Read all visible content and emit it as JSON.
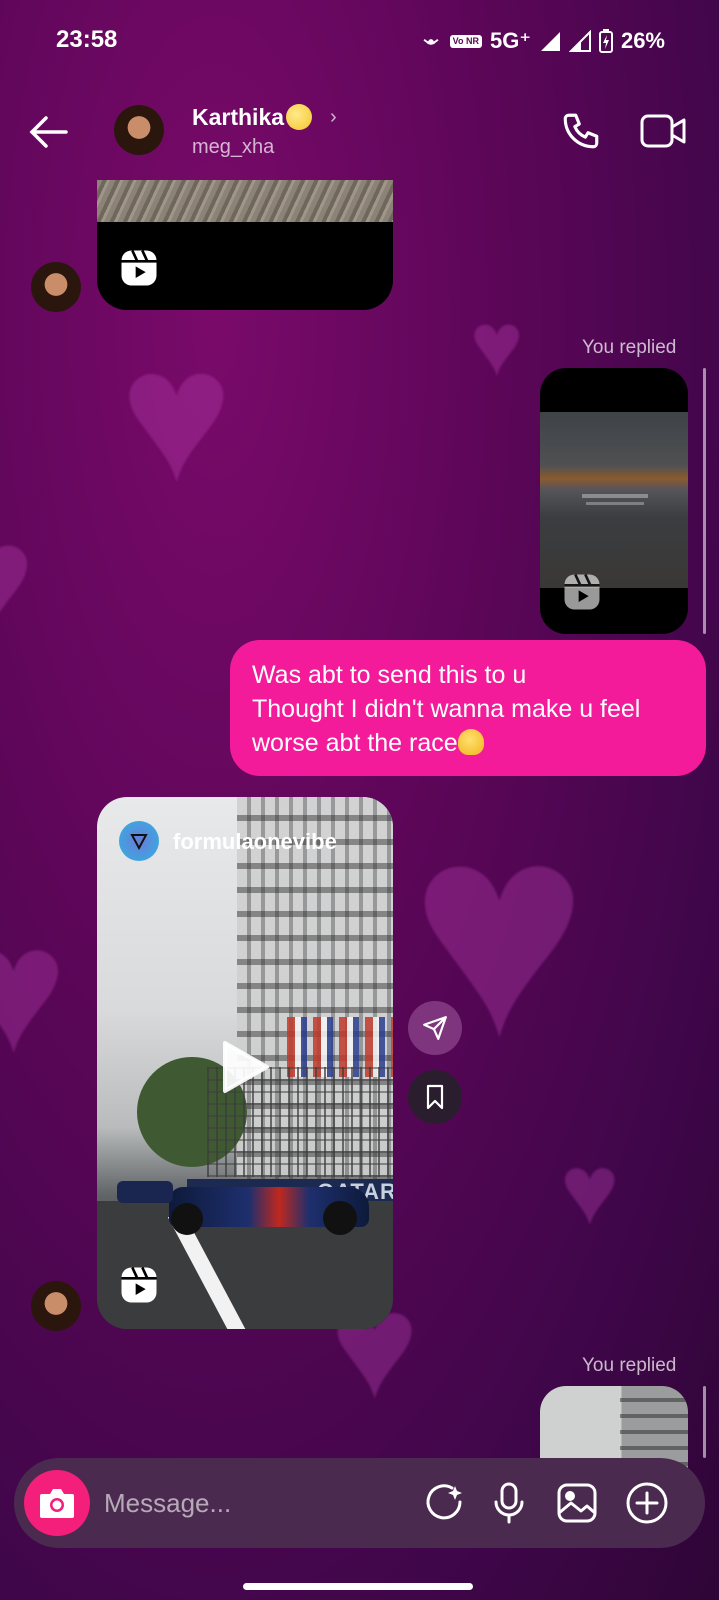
{
  "status_bar": {
    "time": "23:58",
    "volte": "Vo NR",
    "network": "5G⁺",
    "battery": "26%"
  },
  "header": {
    "contact_name": "Karthika",
    "contact_handle": "meg_xha",
    "name_chevron": "›"
  },
  "messages": {
    "you_replied_1": "You replied",
    "you_replied_2": "You replied",
    "text_bubble": {
      "line1": "Was abt to send this to u",
      "line2": "Thought I didn't wanna make u feel",
      "line3": "worse abt the race"
    },
    "shared_reel": {
      "account": "formulaonevibe",
      "banner_text": "QATAR A"
    }
  },
  "composer": {
    "placeholder": "Message..."
  },
  "icons": {
    "status": [
      "hotspot-icon",
      "volte-icon",
      "signal-icon",
      "battery-icon"
    ],
    "header": [
      "back-arrow-icon",
      "phone-icon",
      "video-camera-icon"
    ],
    "composer": [
      "camera-icon",
      "sticker-sparkle-icon",
      "microphone-icon",
      "gallery-icon",
      "plus-circle-icon"
    ],
    "reel": [
      "reels-icon",
      "play-icon",
      "share-icon",
      "bookmark-icon"
    ]
  },
  "colors": {
    "bubble": "#f41b9a",
    "camera_button": "#f31f7a",
    "background": "#5c0658"
  }
}
